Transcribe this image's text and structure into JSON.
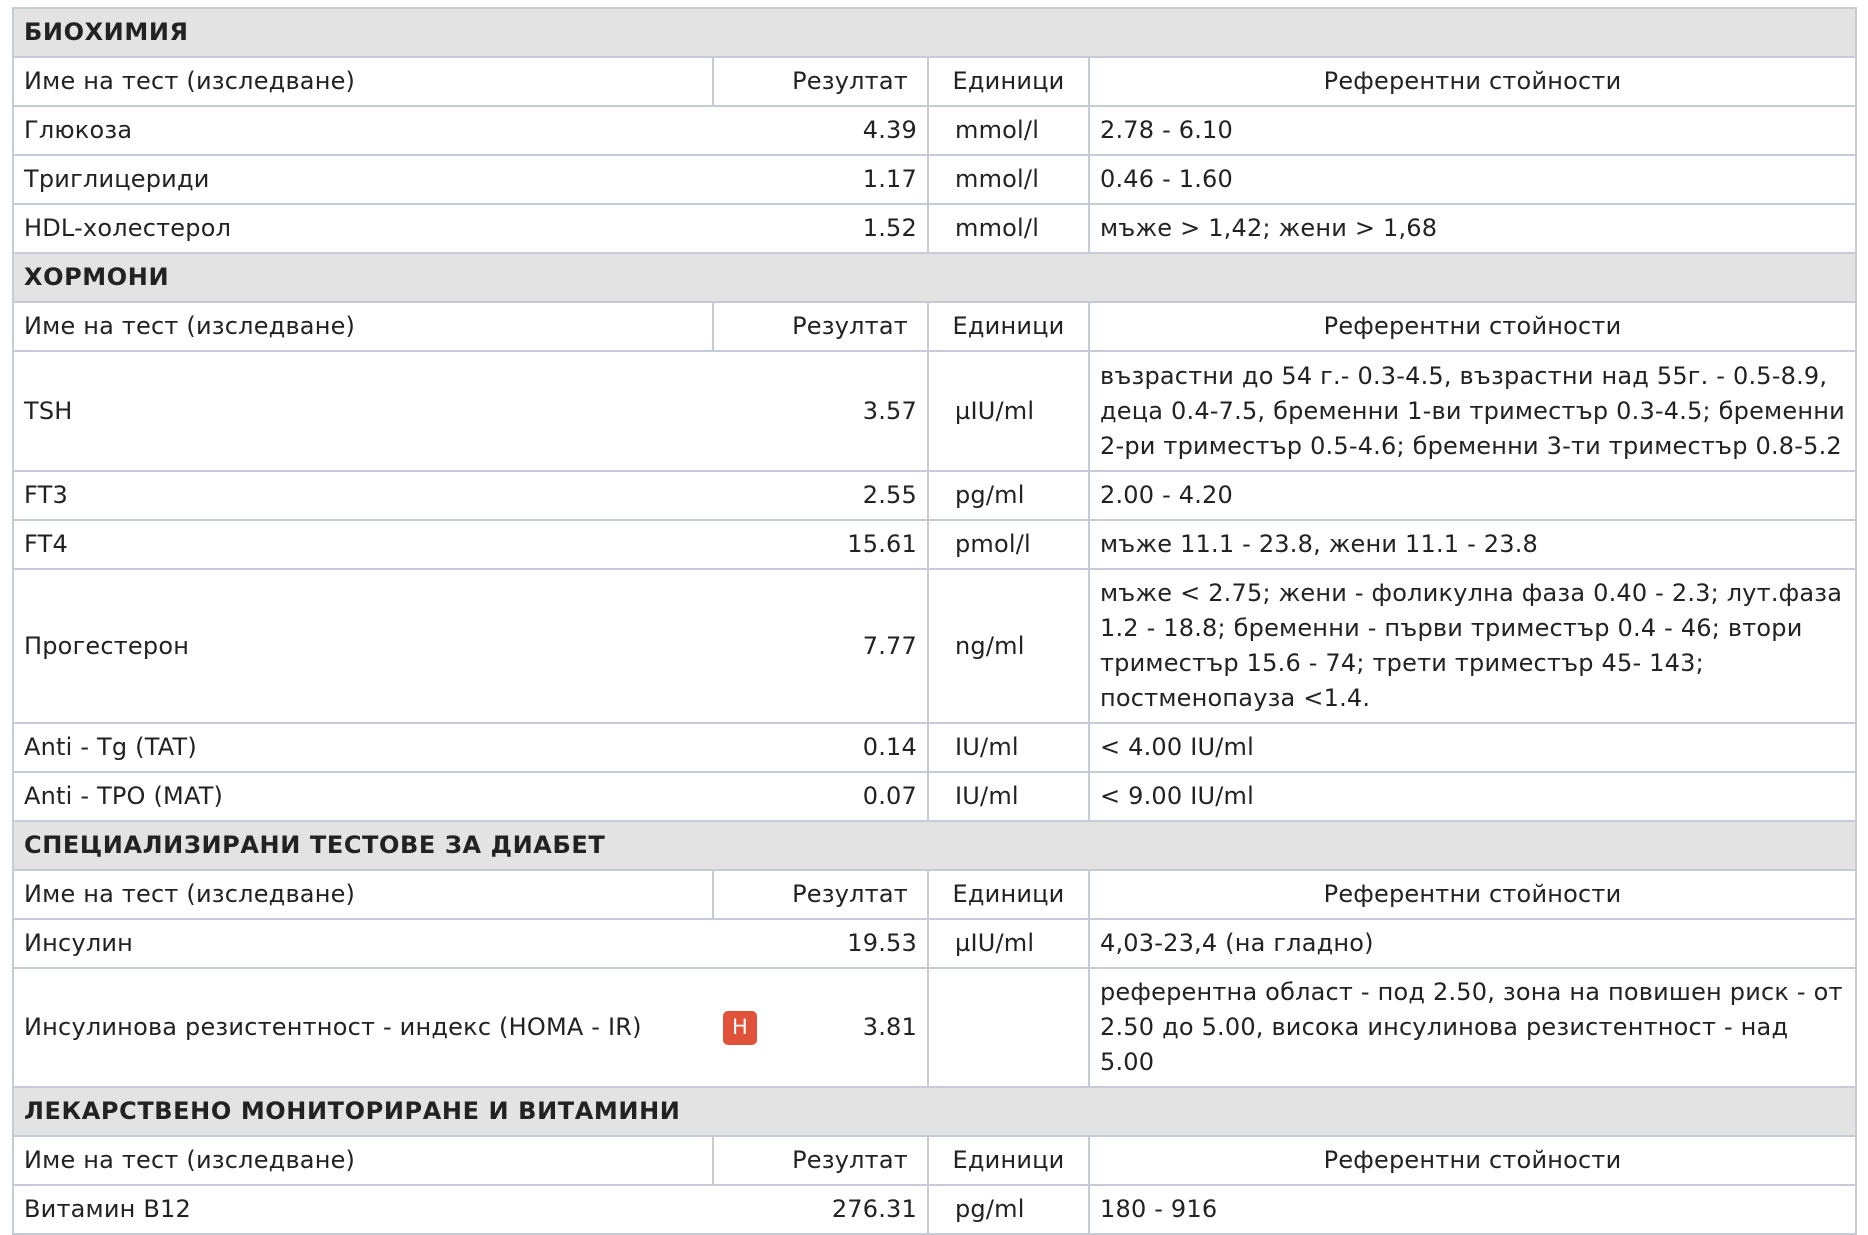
{
  "columns": {
    "name": "Име на тест (изследване)",
    "result": "Резултат",
    "units": "Единици",
    "reference": "Референтни стойности"
  },
  "sections": [
    {
      "title": "БИОХИМИЯ",
      "rows": [
        {
          "name": "Глюкоза",
          "flag": "",
          "result": "4.39",
          "units": "mmol/l",
          "reference": "2.78 - 6.10"
        },
        {
          "name": "Триглицериди",
          "flag": "",
          "result": "1.17",
          "units": "mmol/l",
          "reference": "0.46 - 1.60"
        },
        {
          "name": "HDL-холестерол",
          "flag": "",
          "result": "1.52",
          "units": "mmol/l",
          "reference": "мъже > 1,42; жени > 1,68"
        }
      ]
    },
    {
      "title": "ХОРМОНИ",
      "rows": [
        {
          "name": "TSH",
          "flag": "",
          "result": "3.57",
          "units": "µIU/ml",
          "reference": "възрастни до 54 г.- 0.3-4.5, възрастни над 55г. - 0.5-8.9, деца 0.4-7.5, бременни 1-ви триместър 0.3-4.5; бременни 2-ри триместър 0.5-4.6; бременни 3-ти триместър 0.8-5.2"
        },
        {
          "name": "FT3",
          "flag": "",
          "result": "2.55",
          "units": "pg/ml",
          "reference": "2.00 - 4.20"
        },
        {
          "name": "FT4",
          "flag": "",
          "result": "15.61",
          "units": "pmol/l",
          "reference": "мъже 11.1 - 23.8, жени 11.1 - 23.8"
        },
        {
          "name": "Прогестерон",
          "flag": "",
          "result": "7.77",
          "units": "ng/ml",
          "reference": "мъже < 2.75; жени - фоликулна фаза 0.40 - 2.3; лут.фаза 1.2 - 18.8; бременни - първи триместър 0.4 - 46; втори триместър 15.6 - 74; трети триместър 45- 143; постменопауза <1.4."
        },
        {
          "name": "Anti - Tg (TAT)",
          "flag": "",
          "result": "0.14",
          "units": "IU/ml",
          "reference": "< 4.00 IU/ml"
        },
        {
          "name": "Anti - TPO (MAT)",
          "flag": "",
          "result": "0.07",
          "units": "IU/ml",
          "reference": "< 9.00 IU/ml"
        }
      ]
    },
    {
      "title": "СПЕЦИАЛИЗИРАНИ ТЕСТОВЕ ЗА ДИАБЕТ",
      "rows": [
        {
          "name": "Инсулин",
          "flag": "",
          "result": "19.53",
          "units": "µIU/ml",
          "reference": "4,03-23,4 (на гладно)"
        },
        {
          "name": "Инсулинова резистентност - индекс (HOMA - IR)",
          "flag": "H",
          "result": "3.81",
          "units": "",
          "reference": "референтна област - под 2.50, зона на повишен риск - от 2.50 до 5.00, висока инсулинова резистентност - над 5.00"
        }
      ]
    },
    {
      "title": "ЛЕКАРСТВЕНО МОНИТОРИРАНЕ И ВИТАМИНИ",
      "rows": [
        {
          "name": "Витамин B12",
          "flag": "",
          "result": "276.31",
          "units": "pg/ml",
          "reference": "180 - 916"
        }
      ]
    }
  ],
  "colors": {
    "section_bg": "#e3e3e3",
    "border": "#c6ccd6",
    "flag_high": "#e0523a"
  }
}
